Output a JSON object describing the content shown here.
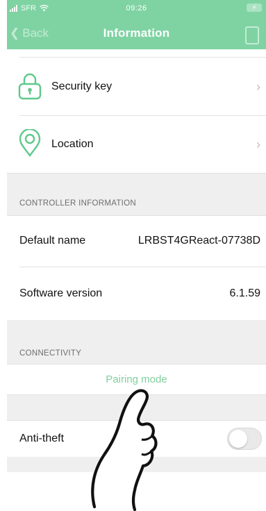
{
  "status_bar": {
    "carrier": "SFR",
    "time": "09:26"
  },
  "nav": {
    "back_label": "Back",
    "title": "Information"
  },
  "menu": [
    {
      "label": "Security key",
      "icon": "lock-icon",
      "accent": "#5fc98c"
    },
    {
      "label": "Location",
      "icon": "location-pin-icon",
      "accent": "#5fc98c"
    }
  ],
  "controller_information": {
    "section_title": "CONTROLLER INFORMATION",
    "rows": [
      {
        "label": "Default name",
        "value": "LRBST4GReact-07738D"
      },
      {
        "label": "Software version",
        "value": "6.1.59"
      }
    ]
  },
  "connectivity": {
    "section_title": "CONNECTIVITY",
    "pairing_label": "Pairing mode",
    "pairing_color": "#7fcf9d"
  },
  "anti_theft": {
    "label": "Anti-theft",
    "enabled": false
  },
  "colors": {
    "header": "#7fd3a3",
    "section_background": "#efefef"
  }
}
